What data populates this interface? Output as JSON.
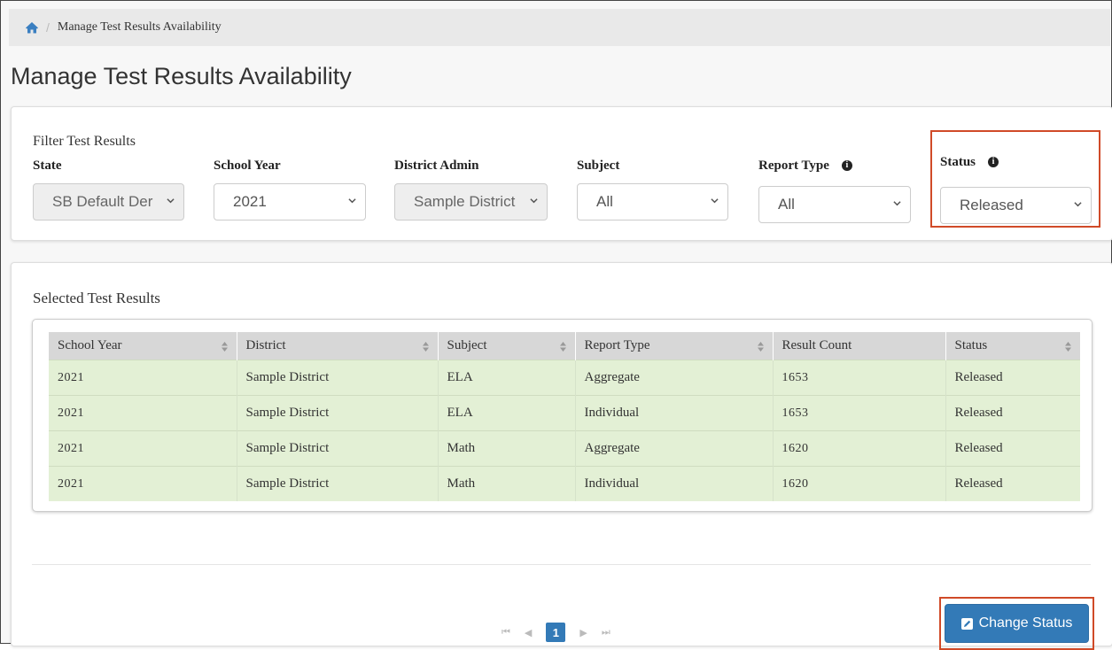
{
  "breadcrumb": {
    "home_icon": "home-icon",
    "current": "Manage Test Results Availability"
  },
  "page": {
    "title": "Manage Test Results Availability"
  },
  "filters": {
    "heading": "Filter Test Results",
    "state": {
      "label": "State",
      "value": "SB Default Der",
      "disabled": true
    },
    "school_year": {
      "label": "School Year",
      "value": "2021"
    },
    "district_admin": {
      "label": "District Admin",
      "value": "Sample District",
      "disabled": true
    },
    "subject": {
      "label": "Subject",
      "value": "All"
    },
    "report_type": {
      "label": "Report Type",
      "value": "All",
      "info_icon": "info-icon"
    },
    "status": {
      "label": "Status",
      "value": "Released",
      "info_icon": "info-icon"
    }
  },
  "results": {
    "heading": "Selected Test Results",
    "columns": [
      "School Year",
      "District",
      "Subject",
      "Report Type",
      "Result Count",
      "Status"
    ],
    "rows": [
      [
        "2021",
        "Sample District",
        "ELA",
        "Aggregate",
        "1653",
        "Released"
      ],
      [
        "2021",
        "Sample District",
        "ELA",
        "Individual",
        "1653",
        "Released"
      ],
      [
        "2021",
        "Sample District",
        "Math",
        "Aggregate",
        "1620",
        "Released"
      ],
      [
        "2021",
        "Sample District",
        "Math",
        "Individual",
        "1620",
        "Released"
      ]
    ],
    "row_color": "#e3f0d5"
  },
  "pagination": {
    "first": "⏮",
    "prev": "◀",
    "current": "1",
    "next": "▶",
    "last": "⏭"
  },
  "actions": {
    "change_status": "Change Status",
    "accent": "#337ab7",
    "highlight": "#d04a28"
  }
}
